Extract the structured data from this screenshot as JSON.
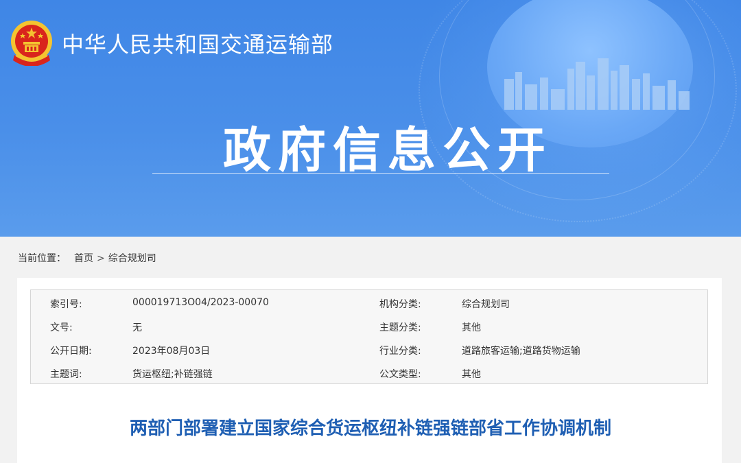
{
  "header": {
    "ministry_name": "中华人民共和国交通运输部",
    "section_title": "政府信息公开",
    "emblem_icon": "national-emblem-icon"
  },
  "breadcrumb": {
    "label": "当前位置：",
    "items": [
      "首页",
      "综合规划司"
    ],
    "separator": ">"
  },
  "metadata": {
    "rows": [
      {
        "k1": "索引号:",
        "v1": "000019713O04/2023-00070",
        "k2": "机构分类:",
        "v2": "综合规划司"
      },
      {
        "k1": "文号:",
        "v1": "无",
        "k2": "主题分类:",
        "v2": "其他"
      },
      {
        "k1": "公开日期:",
        "v1": "2023年08月03日",
        "k2": "行业分类:",
        "v2": "道路旅客运输;道路货物运输"
      },
      {
        "k1": "主题词:",
        "v1": "货运枢纽;补链强链",
        "k2": "公文类型:",
        "v2": "其他"
      }
    ]
  },
  "article": {
    "title": "两部门部署建立国家综合货运枢纽补链强链部省工作协调机制"
  },
  "colors": {
    "banner_blue": "#4a8fe9",
    "title_blue": "#1f5fb3",
    "emblem_red": "#d9251c",
    "emblem_gold": "#f4c430"
  }
}
